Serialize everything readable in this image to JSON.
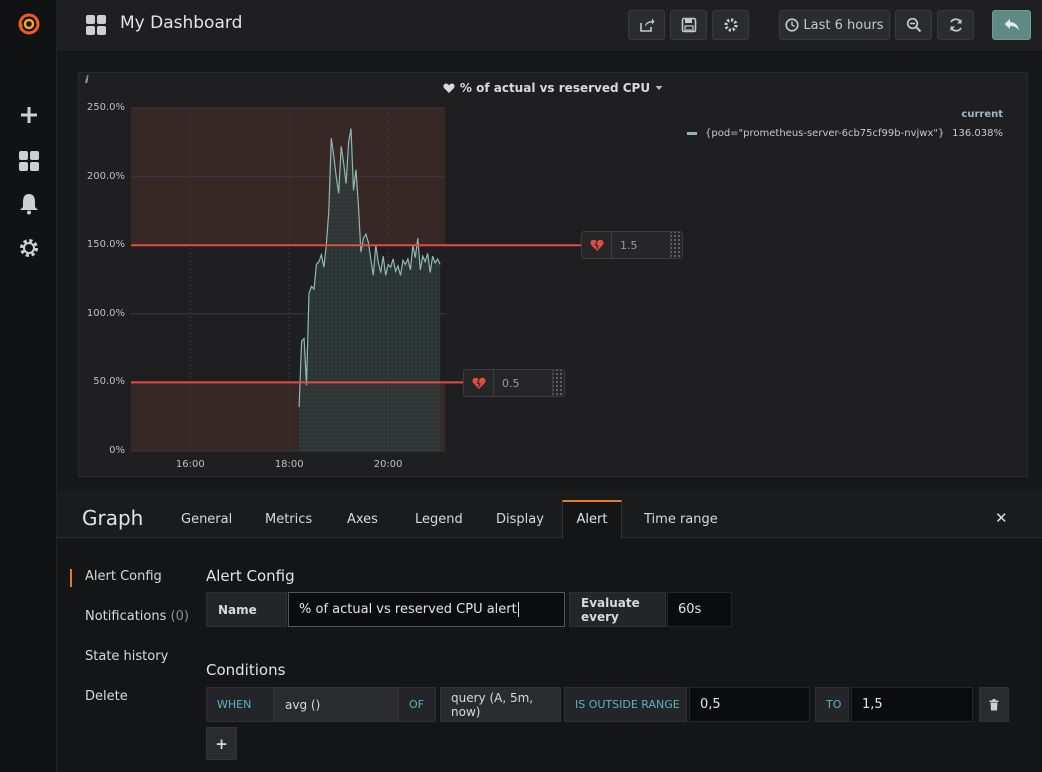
{
  "navbar": {
    "title": "My Dashboard",
    "time_range_label": "Last 6 hours"
  },
  "panel": {
    "title": "% of actual vs reserved CPU",
    "info_label": "i",
    "legend": {
      "header": "current",
      "series_name": "{pod=\"prometheus-server-6cb75cf99b-nvjwx\"}",
      "series_current": "136.038%"
    },
    "thresholds": [
      {
        "value": "1.5"
      },
      {
        "value": "0.5"
      }
    ]
  },
  "chart_data": {
    "type": "line",
    "title": "% of actual vs reserved CPU",
    "y_ticks": [
      "250.0%",
      "200.0%",
      "150.0%",
      "100.0%",
      "50.0%",
      "0%"
    ],
    "x_ticks": [
      "16:00",
      "18:00",
      "20:00"
    ],
    "ylim": [
      0,
      250
    ],
    "grid": true,
    "legend_placement": "top-right",
    "series": [
      {
        "name": "{pod=\"prometheus-server-6cb75cf99b-nvjwx\"}",
        "color": "#8fb8b0",
        "x": [
          18.2,
          18.25,
          18.3,
          18.35,
          18.4,
          18.45,
          18.5,
          18.55,
          18.6,
          18.65,
          18.7,
          18.75,
          18.8,
          18.85,
          18.9,
          18.95,
          19.0,
          19.05,
          19.1,
          19.15,
          19.2,
          19.25,
          19.3,
          19.35,
          19.4,
          19.45,
          19.5,
          19.55,
          19.6,
          19.65,
          19.7,
          19.75,
          19.8,
          19.85,
          19.9,
          19.95,
          20.0,
          20.05,
          20.1,
          20.15,
          20.2,
          20.25,
          20.3,
          20.35,
          20.4,
          20.45,
          20.5,
          20.55,
          20.6,
          20.65,
          20.7,
          20.75,
          20.8,
          20.85,
          20.9,
          20.95,
          21.0,
          21.05
        ],
        "values": [
          32,
          80,
          82,
          48,
          115,
          120,
          118,
          136,
          138,
          143,
          134,
          150,
          175,
          228,
          215,
          200,
          188,
          222,
          210,
          195,
          225,
          235,
          190,
          205,
          178,
          145,
          155,
          158,
          152,
          140,
          128,
          150,
          138,
          130,
          142,
          128,
          136,
          134,
          140,
          131,
          135,
          128,
          139,
          136,
          140,
          132,
          150,
          141,
          155,
          132,
          142,
          138,
          144,
          130,
          142,
          137,
          140,
          136
        ]
      }
    ],
    "thresholds": [
      150,
      50
    ]
  },
  "editor": {
    "title": "Graph",
    "tabs": [
      "General",
      "Metrics",
      "Axes",
      "Legend",
      "Display",
      "Alert",
      "Time range"
    ],
    "active_tab": "Alert",
    "side_nav": {
      "alert_config": "Alert Config",
      "notifications": "Notifications",
      "notifications_count": "(0)",
      "state_history": "State history",
      "delete": "Delete"
    },
    "alert_config": {
      "section_title": "Alert Config",
      "name_label": "Name",
      "name_value": "% of actual vs reserved CPU alert",
      "evaluate_label": "Evaluate every",
      "evaluate_value": "60s"
    },
    "conditions": {
      "section_title": "Conditions",
      "when_label": "WHEN",
      "reducer": "avg ()",
      "of_label": "OF",
      "query": "query (A, 5m, now)",
      "evaluator": "IS OUTSIDE RANGE",
      "from_value": "0,5",
      "to_label": "TO",
      "to_value": "1,5",
      "add_label": "+"
    }
  },
  "colors": {
    "threshold_line": "#e24d42",
    "series": "#8fb8b0",
    "accent": "#eb7b18"
  }
}
